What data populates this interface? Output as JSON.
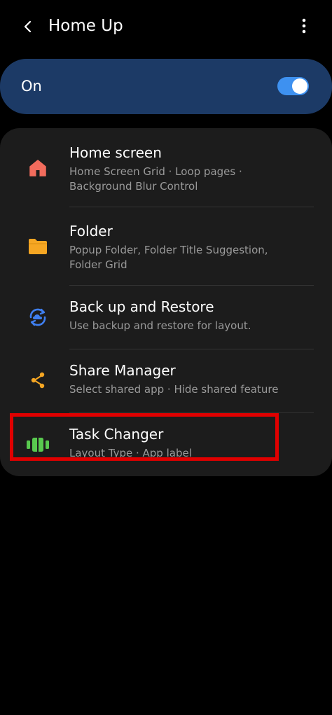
{
  "header": {
    "title": "Home Up",
    "back_icon": "chevron-left-icon",
    "more_icon": "more-vertical-icon"
  },
  "master_switch": {
    "label": "On",
    "state": "on",
    "accent_color": "#3e91f0"
  },
  "menu": {
    "items": [
      {
        "title": "Home screen",
        "subtitle": "Home Screen Grid · Loop pages · Background Blur Control",
        "icon": "home-icon",
        "icon_color": "#f26c5d"
      },
      {
        "title": "Folder",
        "subtitle": "Popup Folder, Folder Title Suggestion, Folder Grid",
        "icon": "folder-icon",
        "icon_color": "#f5a623"
      },
      {
        "title": "Back up and Restore",
        "subtitle": "Use backup and restore for layout.",
        "icon": "cloud-sync-icon",
        "icon_color": "#3f7ff0"
      },
      {
        "title": "Share Manager",
        "subtitle": "Select shared app · Hide shared feature",
        "icon": "share-icon",
        "icon_color": "#f5a623"
      },
      {
        "title": "Task Changer",
        "subtitle": "Layout Type · App label",
        "icon": "task-changer-icon",
        "icon_color": "#59c94f"
      }
    ]
  },
  "highlight_color": "#e00000"
}
